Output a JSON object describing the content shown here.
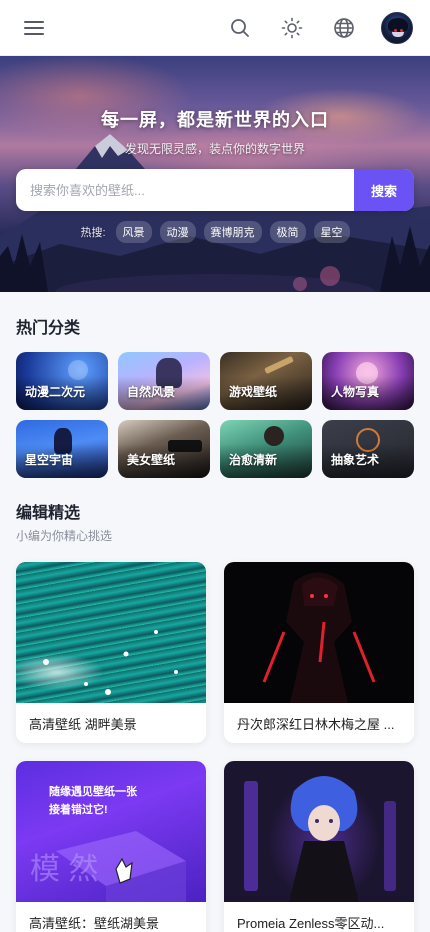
{
  "header": {
    "menu_icon": "hamburger-menu-icon",
    "search_icon": "search-icon",
    "theme_icon": "sun-icon",
    "language_icon": "globe-icon",
    "avatar_icon": "user-avatar"
  },
  "hero": {
    "title": "每一屏，都是新世界的入口",
    "subtitle": "发现无限灵感，装点你的数字世界",
    "search_placeholder": "搜索你喜欢的壁纸...",
    "search_button": "搜索",
    "hot_label": "热搜:",
    "hot_tags": [
      "风景",
      "动漫",
      "赛博朋克",
      "极简",
      "星空"
    ]
  },
  "categories": {
    "title": "热门分类",
    "items": [
      {
        "label": "动漫二次元"
      },
      {
        "label": "自然风景"
      },
      {
        "label": "游戏壁纸"
      },
      {
        "label": "人物写真"
      },
      {
        "label": "星空宇宙"
      },
      {
        "label": "美女壁纸"
      },
      {
        "label": "治愈清新"
      },
      {
        "label": "抽象艺术"
      }
    ]
  },
  "editor_picks": {
    "title": "编辑精选",
    "subtitle": "小编为你精心挑选",
    "cards": [
      {
        "caption": "高清壁纸 湖畔美景"
      },
      {
        "caption": "丹次郎深红日林木梅之屋 ..."
      },
      {
        "caption": "高清壁纸：壁纸湖美景",
        "poster_text": [
          "随缘遇见壁纸一张",
          "接着错过它!"
        ]
      },
      {
        "caption": "Promeia Zenless零区动..."
      }
    ]
  },
  "colors": {
    "accent": "#6b52f5",
    "background": "#f6f7fb"
  }
}
